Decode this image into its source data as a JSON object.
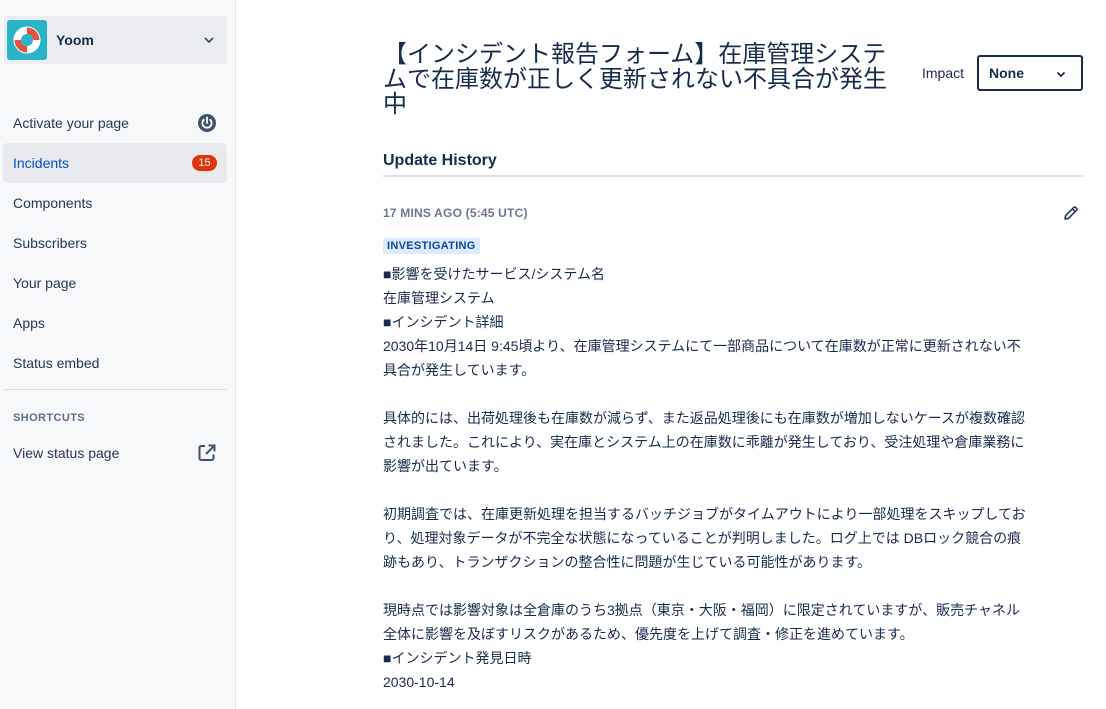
{
  "sidebar": {
    "org_name": "Yoom",
    "nav": [
      {
        "label": "Activate your page",
        "icon": "power-icon"
      },
      {
        "label": "Incidents",
        "badge": "15",
        "active": true
      },
      {
        "label": "Components"
      },
      {
        "label": "Subscribers"
      },
      {
        "label": "Your page"
      },
      {
        "label": "Apps"
      },
      {
        "label": "Status embed"
      }
    ],
    "shortcuts_heading": "SHORTCUTS",
    "shortcuts": [
      {
        "label": "View status page",
        "icon": "external-link-icon"
      }
    ]
  },
  "incident": {
    "title": "【インシデント報告フォーム】在庫管理システムで在庫数が正しく更新されない不具合が発生中",
    "impact_label": "Impact",
    "impact_value": "None"
  },
  "history": {
    "heading": "Update History",
    "updates": [
      {
        "timestamp": "17 MINS AGO (5:45 UTC)",
        "status": "INVESTIGATING",
        "lines": [
          "■影響を受けたサービス/システム名",
          "在庫管理システム",
          "■インシデント詳細",
          "2030年10月14日 9:45頃より、在庫管理システムにて一部商品について在庫数が正常に更新されない不具合が発生しています。",
          "",
          "具体的には、出荷処理後も在庫数が減らず、また返品処理後にも在庫数が増加しないケースが複数確認されました。これにより、実在庫とシステム上の在庫数に乖離が発生しており、受注処理や倉庫業務に影響が出ています。",
          "",
          "初期調査では、在庫更新処理を担当するバッチジョブがタイムアウトにより一部処理をスキップしており、処理対象データが不完全な状態になっていることが判明しました。ログ上では DBロック競合の痕跡もあり、トランザクションの整合性に問題が生じている可能性があります。",
          "",
          "現時点では影響対象は全倉庫のうち3拠点（東京・大阪・福岡）に限定されていますが、販売チャネル全体に影響を及ぼすリスクがあるため、優先度を上げて調査・修正を進めています。",
          "■インシデント発見日時",
          "2030-10-14"
        ]
      }
    ]
  },
  "colors": {
    "accent": "#0052cc",
    "badge": "#de350b",
    "logo_bg": "#2ab4c9",
    "status_tag_bg": "#deebff",
    "status_tag_text": "#0747a6"
  }
}
